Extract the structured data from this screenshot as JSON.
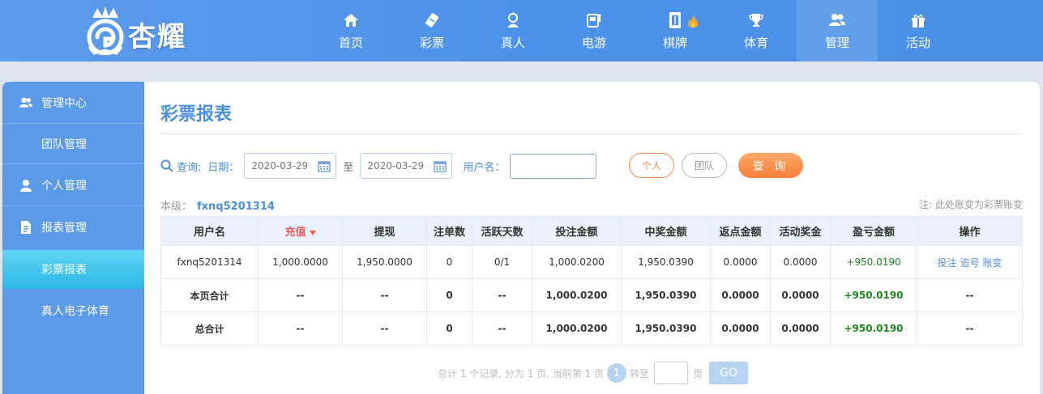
{
  "brand": {
    "name": "杏耀"
  },
  "nav": [
    {
      "label": "首页",
      "icon": "home-icon"
    },
    {
      "label": "彩票",
      "icon": "lottery-icon"
    },
    {
      "label": "真人",
      "icon": "live-dealer-icon"
    },
    {
      "label": "电游",
      "icon": "slot-machine-icon"
    },
    {
      "label": "棋牌",
      "icon": "mahjong-icon"
    },
    {
      "label": "体育",
      "icon": "trophy-icon"
    },
    {
      "label": "管理",
      "icon": "users-icon"
    },
    {
      "label": "活动",
      "icon": "gift-icon"
    }
  ],
  "nav_active": "管理",
  "sidebar": {
    "items": [
      {
        "label": "管理中心",
        "icon": "users-icon"
      },
      {
        "label": "团队管理"
      },
      {
        "label": "个人管理",
        "icon": "user-icon"
      },
      {
        "label": "报表管理",
        "icon": "report-icon"
      },
      {
        "label": "彩票报表"
      },
      {
        "label": "真人电子体育"
      }
    ]
  },
  "page": {
    "title": "彩票报表"
  },
  "filter": {
    "query_label": "查询:",
    "date_label": "日期：",
    "start_date": "2020-03-29",
    "to_label": "至",
    "end_date": "2020-03-29",
    "username_label": "用户名：",
    "username_value": "",
    "personal_btn": "个人",
    "team_btn": "团队",
    "query_btn": "查 询"
  },
  "level": {
    "label": "本级：",
    "user": "fxnq5201314"
  },
  "note": "注: 此处账变为彩票账变",
  "table": {
    "headers": [
      "用户名",
      "充值",
      "提现",
      "注单数",
      "活跃天数",
      "投注金额",
      "中奖金额",
      "返点金额",
      "活动奖金",
      "盈亏金额",
      "操作"
    ],
    "rows": [
      [
        "fxnq5201314",
        "1,000.0000",
        "1,950.0000",
        "0",
        "0/1",
        "1,000.0200",
        "1,950.0390",
        "0.0000",
        "0.0000",
        "+950.0190"
      ]
    ],
    "row_ops": [
      "投注",
      "追号",
      "账变"
    ],
    "page_total": [
      "本页合计",
      "--",
      "--",
      "0",
      "--",
      "1,000.0200",
      "1,950.0390",
      "0.0000",
      "0.0000",
      "+950.0190",
      "--"
    ],
    "grand_total": [
      "总合计",
      "--",
      "--",
      "0",
      "--",
      "1,000.0200",
      "1,950.0390",
      "0.0000",
      "0.0000",
      "+950.0190",
      "--"
    ]
  },
  "pager": {
    "summary": "总计 1 个记录, 分为 1 页, 当前第 1 页",
    "current": "1",
    "goto_label": "转至",
    "page_unit": "页",
    "go_btn": "GO"
  },
  "colors": {
    "accent": "#4b8fe0",
    "nav_bg": "#4d92ea",
    "profit": "#1c8a1c",
    "sort": "#f25a5a",
    "query_btn": "#f57f38"
  }
}
